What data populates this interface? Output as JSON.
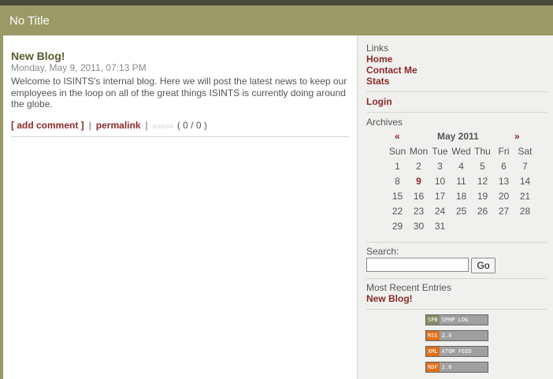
{
  "header": {
    "title": "No Title"
  },
  "post": {
    "title": "New Blog!",
    "date": "Monday, May 9, 2011, 07:13 PM",
    "body": "Welcome to ISINTS's internal blog. Here we will post the latest news to keep our employees in the loop on all of the great things ISINTS is currently doing around the globe.",
    "add_comment": "[ add comment ]",
    "sep": "|",
    "permalink": "permalink",
    "stars": "○○○○○",
    "rating": "( 0 / 0 )"
  },
  "sidebar": {
    "links_heading": "Links",
    "links": [
      "Home",
      "Contact Me",
      "Stats"
    ],
    "login": "Login",
    "archives_heading": "Archives",
    "calendar": {
      "prev": "«",
      "next": "»",
      "month": "May 2011",
      "weekdays": [
        "Sun",
        "Mon",
        "Tue",
        "Wed",
        "Thu",
        "Fri",
        "Sat"
      ],
      "weeks": [
        [
          "1",
          "2",
          "3",
          "4",
          "5",
          "6",
          "7"
        ],
        [
          "8",
          "9",
          "10",
          "11",
          "12",
          "13",
          "14"
        ],
        [
          "15",
          "16",
          "17",
          "18",
          "19",
          "20",
          "21"
        ],
        [
          "22",
          "23",
          "24",
          "25",
          "26",
          "27",
          "28"
        ],
        [
          "29",
          "30",
          "31",
          "",
          "",
          "",
          ""
        ]
      ],
      "highlight": "9"
    },
    "search_label": "Search:",
    "search_value": "",
    "go_label": "Go",
    "recent_heading": "Most Recent Entries",
    "recent_entry": "New Blog!",
    "badges": [
      {
        "left": "SPB",
        "right": "SPHP LOG",
        "color": "#8a8a6a"
      },
      {
        "left": "RSS",
        "right": "2.0",
        "color": "#e0701a"
      },
      {
        "left": "XML",
        "right": "ATOM FEED",
        "color": "#e0701a"
      },
      {
        "left": "RDF",
        "right": "1.0",
        "color": "#e0701a"
      }
    ]
  }
}
